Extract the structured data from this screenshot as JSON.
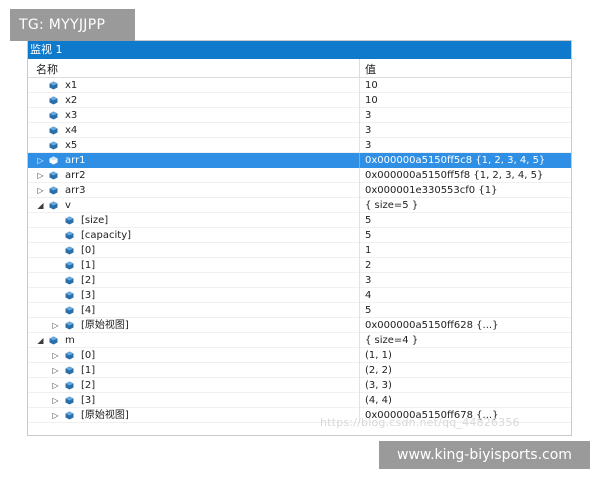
{
  "watermarks": {
    "top": "TG: MYYJJPP",
    "middle": "https://blog.csdn.net/qq_44826356",
    "bottom": "www.king-biyisports.com"
  },
  "window": {
    "title": "监视 1"
  },
  "columns": {
    "name": "名称",
    "value": "值"
  },
  "colors": {
    "titlebar": "#0f7acb",
    "selection": "#2f8fe5",
    "object_icon": "#2a6fa8"
  },
  "rows": [
    {
      "name": "x1",
      "value": "10",
      "depth": 0,
      "expander": "none",
      "selected": false
    },
    {
      "name": "x2",
      "value": "10",
      "depth": 0,
      "expander": "none",
      "selected": false
    },
    {
      "name": "x3",
      "value": "3",
      "depth": 0,
      "expander": "none",
      "selected": false
    },
    {
      "name": "x4",
      "value": "3",
      "depth": 0,
      "expander": "none",
      "selected": false
    },
    {
      "name": "x5",
      "value": "3",
      "depth": 0,
      "expander": "none",
      "selected": false
    },
    {
      "name": "arr1",
      "value": "0x000000a5150ff5c8 {1, 2, 3, 4, 5}",
      "depth": 0,
      "expander": "collapsed",
      "selected": true
    },
    {
      "name": "arr2",
      "value": "0x000000a5150ff5f8 {1, 2, 3, 4, 5}",
      "depth": 0,
      "expander": "collapsed",
      "selected": false
    },
    {
      "name": "arr3",
      "value": "0x000001e330553cf0 {1}",
      "depth": 0,
      "expander": "collapsed",
      "selected": false
    },
    {
      "name": "v",
      "value": "{ size=5 }",
      "depth": 0,
      "expander": "expanded",
      "selected": false
    },
    {
      "name": "[size]",
      "value": "5",
      "depth": 1,
      "expander": "none",
      "selected": false
    },
    {
      "name": "[capacity]",
      "value": "5",
      "depth": 1,
      "expander": "none",
      "selected": false
    },
    {
      "name": "[0]",
      "value": "1",
      "depth": 1,
      "expander": "none",
      "selected": false
    },
    {
      "name": "[1]",
      "value": "2",
      "depth": 1,
      "expander": "none",
      "selected": false
    },
    {
      "name": "[2]",
      "value": "3",
      "depth": 1,
      "expander": "none",
      "selected": false
    },
    {
      "name": "[3]",
      "value": "4",
      "depth": 1,
      "expander": "none",
      "selected": false
    },
    {
      "name": "[4]",
      "value": "5",
      "depth": 1,
      "expander": "none",
      "selected": false
    },
    {
      "name": "[原始视图]",
      "value": "0x000000a5150ff628 {...}",
      "depth": 1,
      "expander": "collapsed",
      "selected": false
    },
    {
      "name": "m",
      "value": "{ size=4 }",
      "depth": 0,
      "expander": "expanded",
      "selected": false
    },
    {
      "name": "[0]",
      "value": "(1, 1)",
      "depth": 1,
      "expander": "collapsed",
      "selected": false
    },
    {
      "name": "[1]",
      "value": "(2, 2)",
      "depth": 1,
      "expander": "collapsed",
      "selected": false
    },
    {
      "name": "[2]",
      "value": "(3, 3)",
      "depth": 1,
      "expander": "collapsed",
      "selected": false
    },
    {
      "name": "[3]",
      "value": "(4, 4)",
      "depth": 1,
      "expander": "collapsed",
      "selected": false
    },
    {
      "name": "[原始视图]",
      "value": "0x000000a5150ff678 {...}",
      "depth": 1,
      "expander": "collapsed",
      "selected": false
    }
  ]
}
